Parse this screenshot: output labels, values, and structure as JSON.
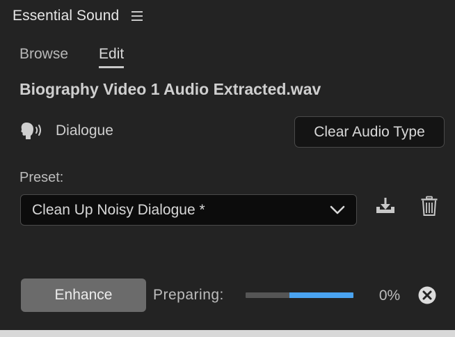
{
  "panel": {
    "title": "Essential Sound"
  },
  "tabs": [
    {
      "label": "Browse",
      "active": false
    },
    {
      "label": "Edit",
      "active": true
    }
  ],
  "clip": {
    "name": "Biography Video 1 Audio Extracted.wav"
  },
  "audio_type": {
    "icon": "dialogue-icon",
    "label": "Dialogue",
    "clear_button_label": "Clear Audio Type"
  },
  "preset": {
    "label": "Preset:",
    "selected_value": "Clean Up Noisy Dialogue *",
    "icons": [
      "save-preset-icon",
      "delete-preset-icon"
    ]
  },
  "enhance": {
    "button_label": "Enhance",
    "status_label": "Preparing:",
    "progress_percent_text": "0%",
    "cancel_icon": "cancel-icon"
  },
  "colors": {
    "panel_background": "#232323",
    "progress_fill": "#4aa3f0",
    "progress_track": "#555555",
    "enhance_button": "#6b6b6b"
  }
}
